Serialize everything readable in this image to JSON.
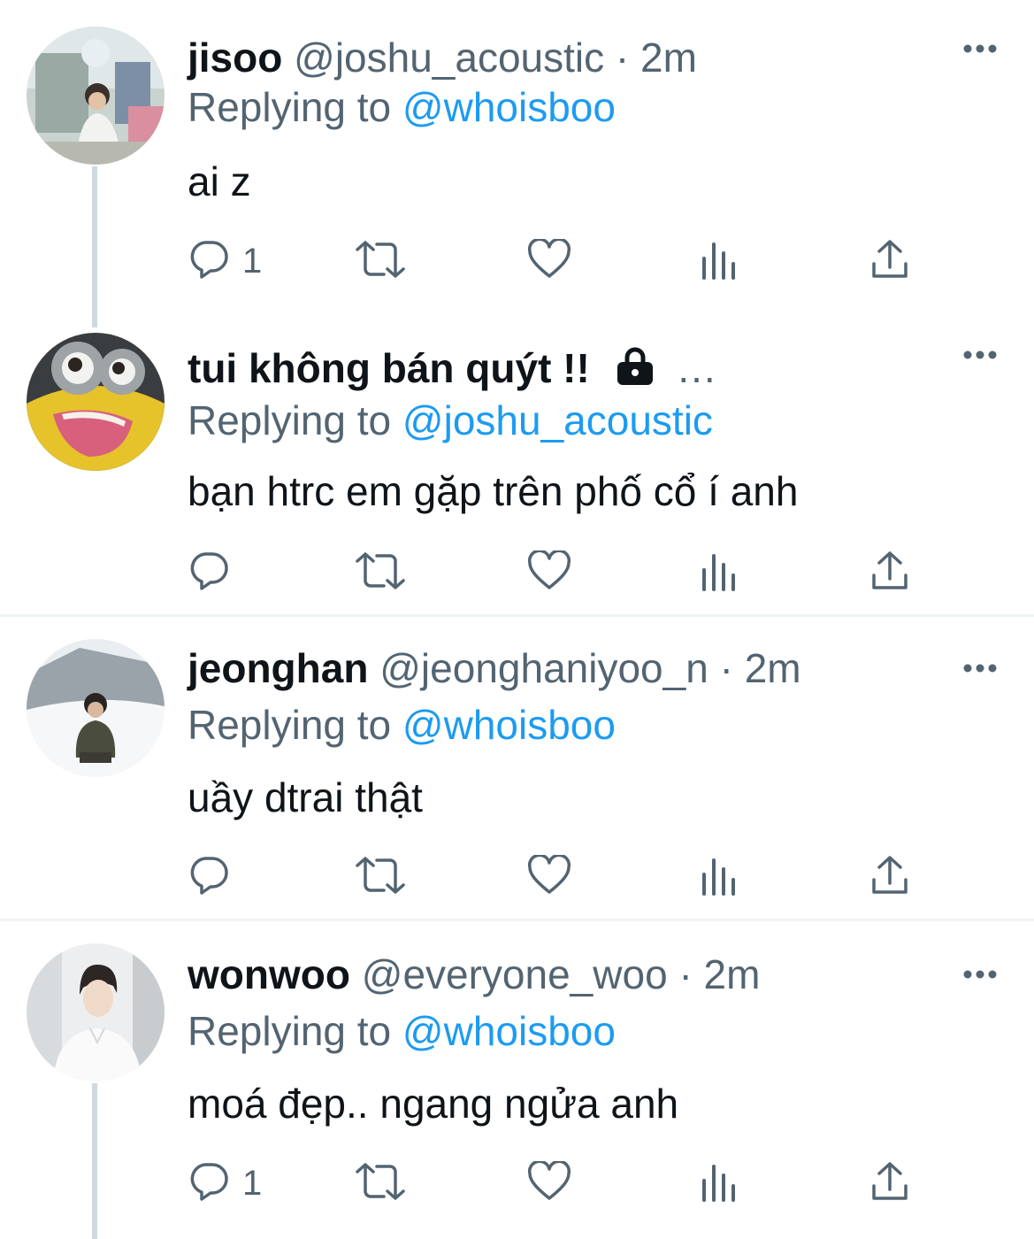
{
  "tweets": [
    {
      "name": "jisoo",
      "handle": "@joshu_acoustic",
      "time": "2m",
      "replying_label": "Replying to",
      "replying_to": "@whoisboo",
      "text": "ai z",
      "reply_count": "1",
      "avatar": "avatar-photo-building"
    },
    {
      "name": "tui không bán quýt !!",
      "ellipsis": "...",
      "locked": true,
      "replying_label": "Replying to",
      "replying_to": "@joshu_acoustic",
      "text": "bạn htrc em gặp trên phố cổ í anh",
      "reply_count": "",
      "avatar": "avatar-minion"
    },
    {
      "name": "jeonghan",
      "handle": "@jeonghaniyoo_n",
      "time": "2m",
      "replying_label": "Replying to",
      "replying_to": "@whoisboo",
      "text": "uầy dtrai thật",
      "reply_count": "",
      "avatar": "avatar-photo-snow"
    },
    {
      "name": "wonwoo",
      "handle": "@everyone_woo",
      "time": "2m",
      "replying_label": "Replying to",
      "replying_to": "@whoisboo",
      "text": "moá đẹp.. ngang ngửa anh",
      "reply_count": "1",
      "avatar": "avatar-photo-white-shirt"
    }
  ],
  "separator": "·",
  "icons": [
    "reply-icon",
    "retweet-icon",
    "like-icon",
    "views-icon",
    "share-icon",
    "more-icon",
    "lock-icon"
  ],
  "colors": {
    "text": "#0f1419",
    "secondary": "#536471",
    "link": "#1d9bf0",
    "divider": "#eff3f4",
    "thread": "#cfd9de"
  }
}
